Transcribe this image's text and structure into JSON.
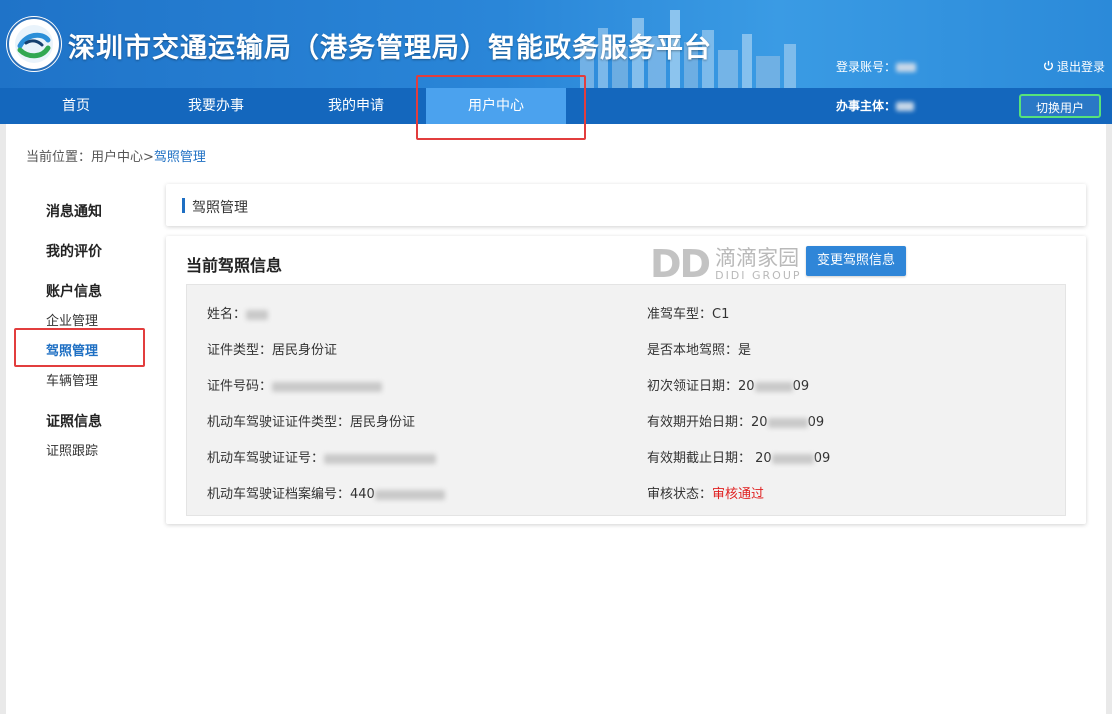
{
  "header": {
    "site_title": "深圳市交通运输局（港务管理局）智能政务服务平台",
    "login_label": "登录账号：",
    "logout_label": "退出登录"
  },
  "nav": {
    "items": [
      {
        "label": "首页"
      },
      {
        "label": "我要办事"
      },
      {
        "label": "我的申请"
      },
      {
        "label": "用户中心"
      }
    ],
    "org_label": "办事主体：",
    "switch_user_label": "切换用户"
  },
  "breadcrumb": {
    "prefix": "当前位置：用户中心>",
    "current": "驾照管理"
  },
  "sidebar": {
    "notifications": "消息通知",
    "my_reviews": "我的评价",
    "account_info": "账户信息",
    "enterprise_mgmt": "企业管理",
    "license_mgmt": "驾照管理",
    "vehicle_mgmt": "车辆管理",
    "cert_info": "证照信息",
    "cert_tracking": "证照跟踪"
  },
  "panel": {
    "title": "驾照管理",
    "info_heading": "当前驾照信息",
    "change_button": "变更驾照信息"
  },
  "watermark": {
    "brand_letters": "DD",
    "brand_cn": "滴滴家园",
    "brand_en": "DIDI GROUP"
  },
  "license": {
    "name_label": "姓名：",
    "id_type_label": "证件类型：",
    "id_type_value": "居民身份证",
    "id_number_label": "证件号码：",
    "mv_id_type_label": "机动车驾驶证证件类型：",
    "mv_id_type_value": "居民身份证",
    "mv_number_label": "机动车驾驶证证号：",
    "archive_label": "机动车驾驶证档案编号：",
    "archive_prefix": "440",
    "class_label": "准驾车型：",
    "class_value": "C1",
    "local_label": "是否本地驾照：",
    "local_value": "是",
    "first_issue_label": "初次领证日期：",
    "first_issue_prefix": "20",
    "first_issue_suffix": "09",
    "valid_start_label": "有效期开始日期：",
    "valid_start_prefix": "20",
    "valid_start_suffix": "09",
    "valid_end_label": "有效期截止日期：",
    "valid_end_prefix": "20",
    "valid_end_suffix": "09",
    "status_label": "审核状态：",
    "status_value": "审核通过"
  },
  "colors": {
    "nav_bg": "#1467bd",
    "nav_active": "#4ba2ee",
    "accent": "#1e6fc3",
    "highlight_red": "#e23d3d",
    "status_red": "#e02020"
  }
}
